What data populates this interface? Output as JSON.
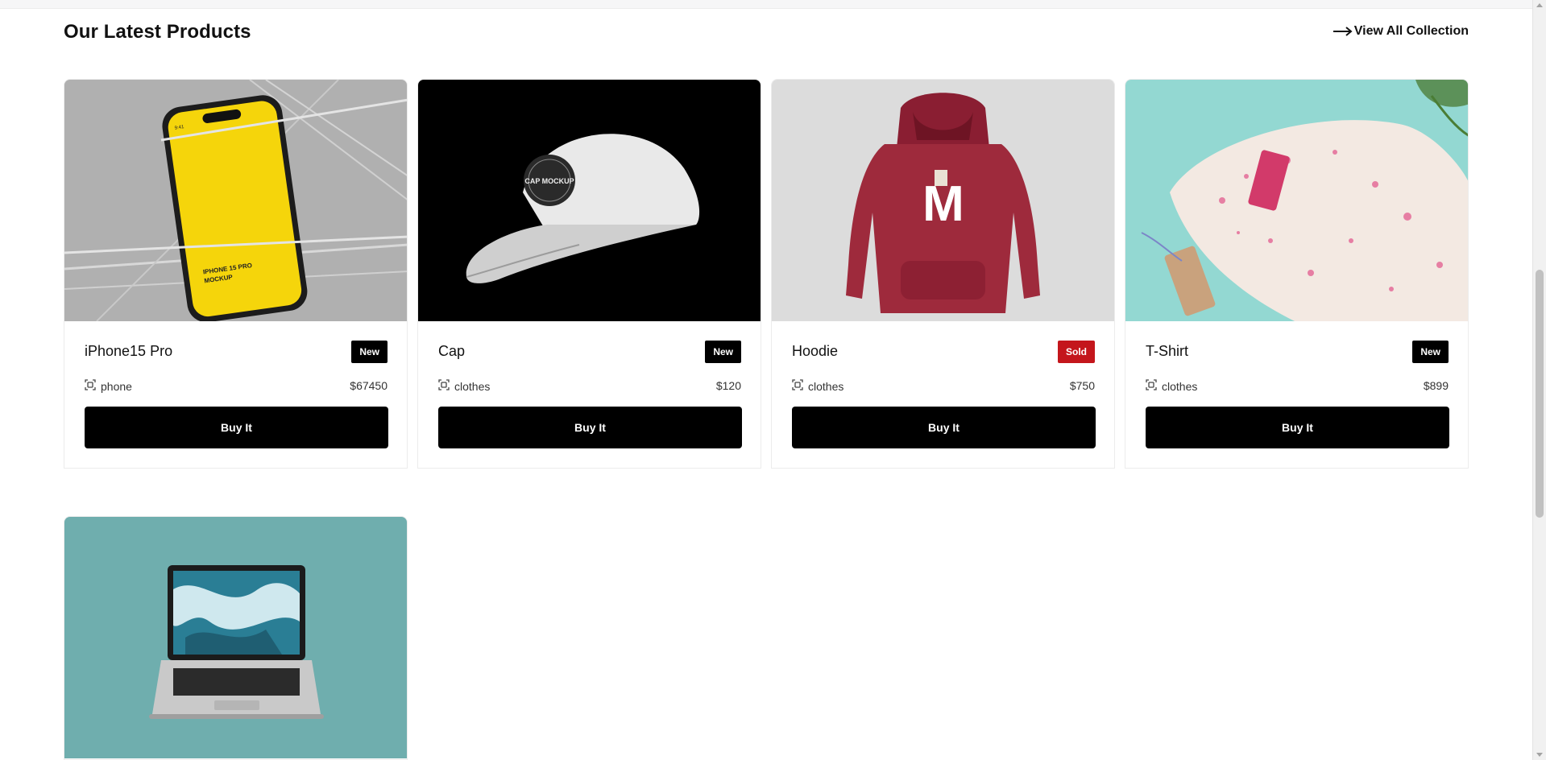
{
  "section": {
    "title": "Our Latest Products",
    "view_all": "View All Collection"
  },
  "products": [
    {
      "name": "iPhone15 Pro",
      "badge": "New",
      "category": "phone",
      "price": "$67450",
      "button": "Buy It"
    },
    {
      "name": "Cap",
      "badge": "New",
      "category": "clothes",
      "price": "$120",
      "button": "Buy It"
    },
    {
      "name": "Hoodie",
      "badge": "Sold",
      "category": "clothes",
      "price": "$750",
      "button": "Buy It"
    },
    {
      "name": "T-Shirt",
      "badge": "New",
      "category": "clothes",
      "price": "$899",
      "button": "Buy It"
    }
  ],
  "images": {
    "phone_text_1": "IPHONE 15 PRO",
    "phone_text_2": "MOCKUP",
    "cap_logo": "CAP MOCKUP",
    "hoodie_letter": "M"
  },
  "colors": {
    "badge_new": "#000000",
    "badge_sold": "#c4161c",
    "button": "#000000"
  }
}
